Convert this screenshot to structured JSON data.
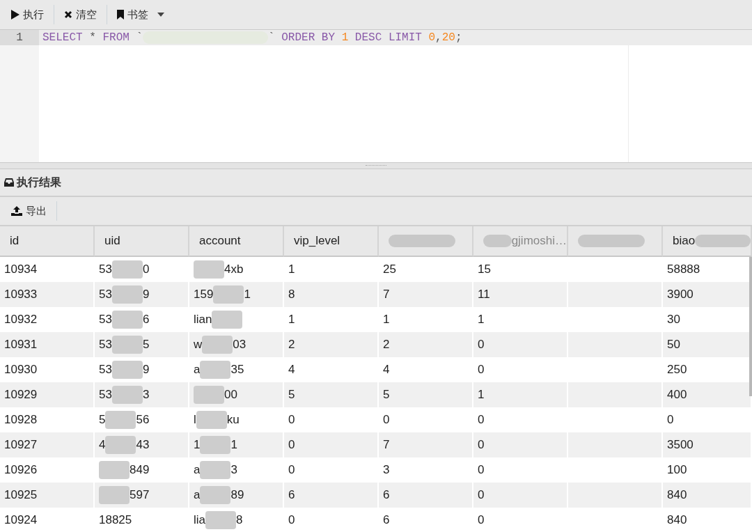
{
  "toolbar": {
    "buttons": [
      {
        "kind": "run",
        "label": "执行"
      },
      {
        "kind": "clear",
        "label": "清空"
      },
      {
        "kind": "bookmark",
        "label": "书签"
      }
    ]
  },
  "editor": {
    "lines": [
      {
        "number": "1",
        "tokens": [
          {
            "kind": "keyword",
            "text": "SELECT"
          },
          {
            "kind": "plain",
            "text": " * "
          },
          {
            "kind": "keyword",
            "text": "FROM"
          },
          {
            "kind": "plain",
            "text": " `"
          },
          {
            "kind": "redacted"
          },
          {
            "kind": "plain",
            "text": "` "
          },
          {
            "kind": "keyword",
            "text": "ORDER BY "
          },
          {
            "kind": "number",
            "text": "1"
          },
          {
            "kind": "keyword",
            "text": " DESC LIMIT "
          },
          {
            "kind": "number",
            "text": "0"
          },
          {
            "kind": "plain",
            "text": ","
          },
          {
            "kind": "number",
            "text": "20"
          },
          {
            "kind": "plain",
            "text": ";"
          }
        ]
      }
    ]
  },
  "results": {
    "title": "执行结果",
    "export_label": "导出",
    "columns": [
      {
        "kind": "text",
        "label": "id"
      },
      {
        "kind": "text",
        "label": "uid"
      },
      {
        "kind": "text",
        "label": "account"
      },
      {
        "kind": "text",
        "label": "vip_level"
      },
      {
        "kind": "redacted"
      },
      {
        "kind": "redacted",
        "after": "gjimoshi…"
      },
      {
        "kind": "redacted"
      },
      {
        "kind": "redacted",
        "before": "biao"
      }
    ],
    "rows": [
      {
        "cells": [
          {
            "kind": "text",
            "text": "10934"
          },
          {
            "kind": "redacted",
            "before": "53",
            "after": "0"
          },
          {
            "kind": "redacted",
            "after": "4xb"
          },
          {
            "kind": "text",
            "text": "1"
          },
          {
            "kind": "text",
            "text": "25"
          },
          {
            "kind": "text",
            "text": "15"
          },
          {
            "kind": "empty"
          },
          {
            "kind": "text",
            "text": "58888"
          }
        ]
      },
      {
        "cells": [
          {
            "kind": "text",
            "text": "10933"
          },
          {
            "kind": "redacted",
            "before": "53",
            "after": "9"
          },
          {
            "kind": "redacted",
            "before": "159",
            "after": "1"
          },
          {
            "kind": "text",
            "text": "8"
          },
          {
            "kind": "text",
            "text": "7"
          },
          {
            "kind": "text",
            "text": "11"
          },
          {
            "kind": "empty"
          },
          {
            "kind": "text",
            "text": "3900"
          }
        ]
      },
      {
        "cells": [
          {
            "kind": "text",
            "text": "10932"
          },
          {
            "kind": "redacted",
            "before": "53",
            "after": "6"
          },
          {
            "kind": "redacted",
            "before": "lian"
          },
          {
            "kind": "text",
            "text": "1"
          },
          {
            "kind": "text",
            "text": "1"
          },
          {
            "kind": "text",
            "text": "1"
          },
          {
            "kind": "empty"
          },
          {
            "kind": "text",
            "text": "30"
          }
        ]
      },
      {
        "cells": [
          {
            "kind": "text",
            "text": "10931"
          },
          {
            "kind": "redacted",
            "before": "53",
            "after": "5"
          },
          {
            "kind": "redacted",
            "before": "w",
            "after": "03"
          },
          {
            "kind": "text",
            "text": "2"
          },
          {
            "kind": "text",
            "text": "2"
          },
          {
            "kind": "text",
            "text": "0"
          },
          {
            "kind": "empty"
          },
          {
            "kind": "text",
            "text": "50"
          }
        ]
      },
      {
        "cells": [
          {
            "kind": "text",
            "text": "10930"
          },
          {
            "kind": "redacted",
            "before": "53",
            "after": "9"
          },
          {
            "kind": "redacted",
            "before": "a",
            "after": "35"
          },
          {
            "kind": "text",
            "text": "4"
          },
          {
            "kind": "text",
            "text": "4"
          },
          {
            "kind": "text",
            "text": "0"
          },
          {
            "kind": "empty"
          },
          {
            "kind": "text",
            "text": "250"
          }
        ]
      },
      {
        "cells": [
          {
            "kind": "text",
            "text": "10929"
          },
          {
            "kind": "redacted",
            "before": "53",
            "after": "3"
          },
          {
            "kind": "redacted",
            "after": "00"
          },
          {
            "kind": "text",
            "text": "5"
          },
          {
            "kind": "text",
            "text": "5"
          },
          {
            "kind": "text",
            "text": "1"
          },
          {
            "kind": "empty"
          },
          {
            "kind": "text",
            "text": "400"
          }
        ]
      },
      {
        "cells": [
          {
            "kind": "text",
            "text": "10928"
          },
          {
            "kind": "redacted",
            "before": "5",
            "after": "56"
          },
          {
            "kind": "redacted",
            "before": "l",
            "after": "ku"
          },
          {
            "kind": "text",
            "text": "0"
          },
          {
            "kind": "text",
            "text": "0"
          },
          {
            "kind": "text",
            "text": "0"
          },
          {
            "kind": "empty"
          },
          {
            "kind": "text",
            "text": "0"
          }
        ]
      },
      {
        "cells": [
          {
            "kind": "text",
            "text": "10927"
          },
          {
            "kind": "redacted",
            "before": "4",
            "after": "43"
          },
          {
            "kind": "redacted",
            "before": "1",
            "after": "1"
          },
          {
            "kind": "text",
            "text": "0"
          },
          {
            "kind": "text",
            "text": "7"
          },
          {
            "kind": "text",
            "text": "0"
          },
          {
            "kind": "empty"
          },
          {
            "kind": "text",
            "text": "3500"
          }
        ]
      },
      {
        "cells": [
          {
            "kind": "text",
            "text": "10926"
          },
          {
            "kind": "redacted",
            "after": "849"
          },
          {
            "kind": "redacted",
            "before": "a",
            "after": "3"
          },
          {
            "kind": "text",
            "text": "0"
          },
          {
            "kind": "text",
            "text": "3"
          },
          {
            "kind": "text",
            "text": "0"
          },
          {
            "kind": "empty"
          },
          {
            "kind": "text",
            "text": "100"
          }
        ]
      },
      {
        "cells": [
          {
            "kind": "text",
            "text": "10925"
          },
          {
            "kind": "redacted",
            "after": "597"
          },
          {
            "kind": "redacted",
            "before": "a",
            "after": "89"
          },
          {
            "kind": "text",
            "text": "6"
          },
          {
            "kind": "text",
            "text": "6"
          },
          {
            "kind": "text",
            "text": "0"
          },
          {
            "kind": "empty"
          },
          {
            "kind": "text",
            "text": "840"
          }
        ]
      },
      {
        "cells": [
          {
            "kind": "text",
            "text": "10924"
          },
          {
            "kind": "text",
            "text": "18825"
          },
          {
            "kind": "redacted",
            "before": "lia",
            "after": "8"
          },
          {
            "kind": "text",
            "text": "0"
          },
          {
            "kind": "text",
            "text": "6"
          },
          {
            "kind": "text",
            "text": "0"
          },
          {
            "kind": "empty"
          },
          {
            "kind": "text",
            "text": "840"
          }
        ]
      }
    ]
  }
}
